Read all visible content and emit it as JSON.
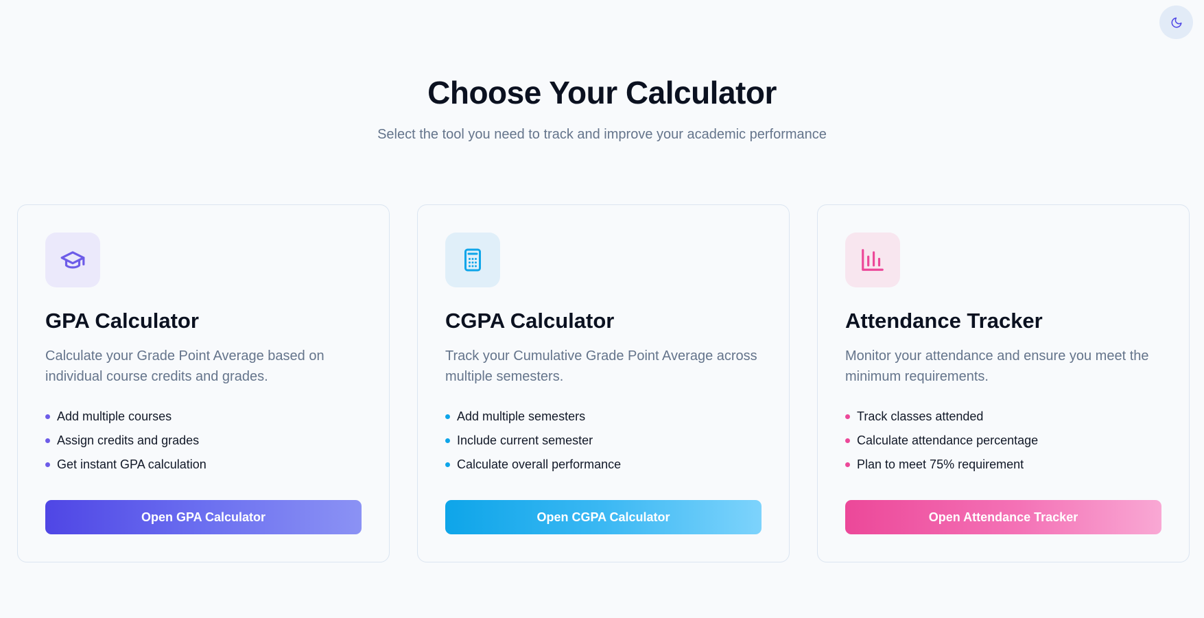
{
  "theme_toggle": {
    "icon": "moon-icon",
    "color": "#4f46e5"
  },
  "header": {
    "title": "Choose Your Calculator",
    "subtitle": "Select the tool you need to track and improve your academic performance"
  },
  "cards": [
    {
      "icon": "graduation-cap-icon",
      "accent": "#6d5ce8",
      "title": "GPA Calculator",
      "description": "Calculate your Grade Point Average based on individual course credits and grades.",
      "features": [
        "Add multiple courses",
        "Assign credits and grades",
        "Get instant GPA calculation"
      ],
      "button_label": "Open GPA Calculator"
    },
    {
      "icon": "calculator-icon",
      "accent": "#0ea5e9",
      "title": "CGPA Calculator",
      "description": "Track your Cumulative Grade Point Average across multiple semesters.",
      "features": [
        "Add multiple semesters",
        "Include current semester",
        "Calculate overall performance"
      ],
      "button_label": "Open CGPA Calculator"
    },
    {
      "icon": "bar-chart-icon",
      "accent": "#ec4899",
      "title": "Attendance Tracker",
      "description": "Monitor your attendance and ensure you meet the minimum requirements.",
      "features": [
        "Track classes attended",
        "Calculate attendance percentage",
        "Plan to meet 75% requirement"
      ],
      "button_label": "Open Attendance Tracker"
    }
  ]
}
